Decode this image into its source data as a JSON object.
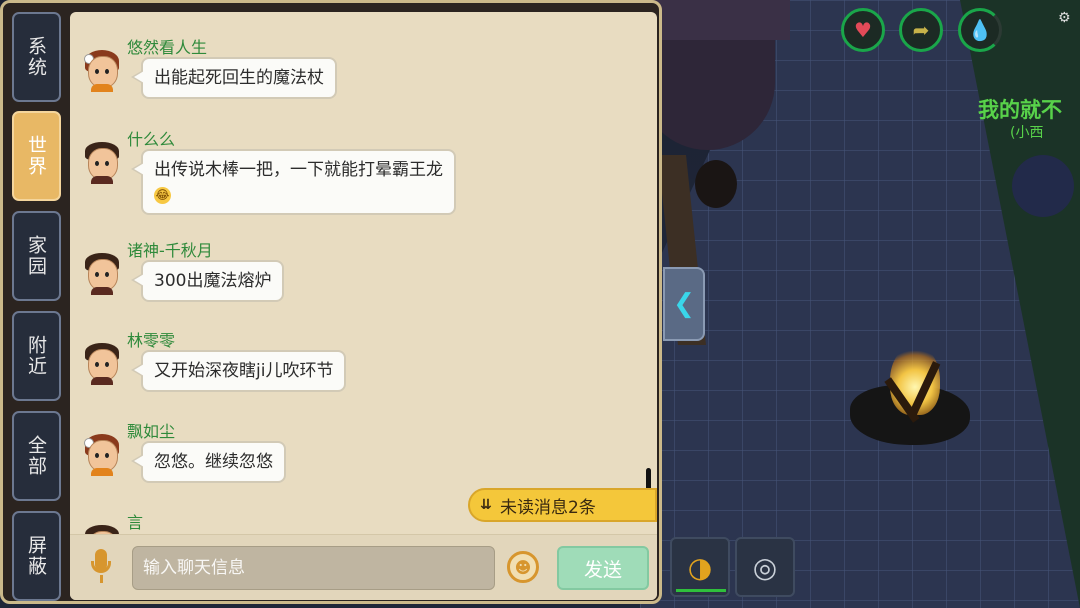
{
  "side_tabs": [
    {
      "label": "系统",
      "active": false
    },
    {
      "label": "世界",
      "active": true
    },
    {
      "label": "家园",
      "active": false
    },
    {
      "label": "附近",
      "active": false
    },
    {
      "label": "全部",
      "active": false
    },
    {
      "label": "屏蔽",
      "active": false
    }
  ],
  "messages": [
    {
      "name": "悠然看人生",
      "text": "出能起死回生的魔法杖",
      "avatar": "female-avatar"
    },
    {
      "name": "什么么",
      "text": "出传说木棒一把，一下就能打晕霸王龙",
      "emoji": "😂",
      "avatar": "male-avatar"
    },
    {
      "name": "诸神-千秋月",
      "text": "300出魔法熔炉",
      "avatar": "male-avatar"
    },
    {
      "name": "林零零",
      "text": "又开始深夜瞎ji儿吹环节",
      "avatar": "male-avatar"
    },
    {
      "name": "飘如尘",
      "text": "忽悠。继续忽悠",
      "avatar": "female-avatar"
    },
    {
      "name": "言",
      "text": "",
      "avatar": "male-avatar"
    }
  ],
  "unread": {
    "label": "未读消息2条",
    "icon": "double-chevron-down-icon"
  },
  "input": {
    "placeholder": "输入聊天信息",
    "value": ""
  },
  "send_label": "发送",
  "game_overlay": {
    "title": "我的就不",
    "subtitle": "小西",
    "status_icons": [
      "heart-icon",
      "food-icon",
      "water-drop-icon"
    ]
  },
  "colors": {
    "name_green": "#2f8a3b",
    "active_tab": "#e8b865",
    "unread_bg": "#f4c73a",
    "send_bg": "#9fdcb8",
    "overlay_green": "#58d24a"
  }
}
